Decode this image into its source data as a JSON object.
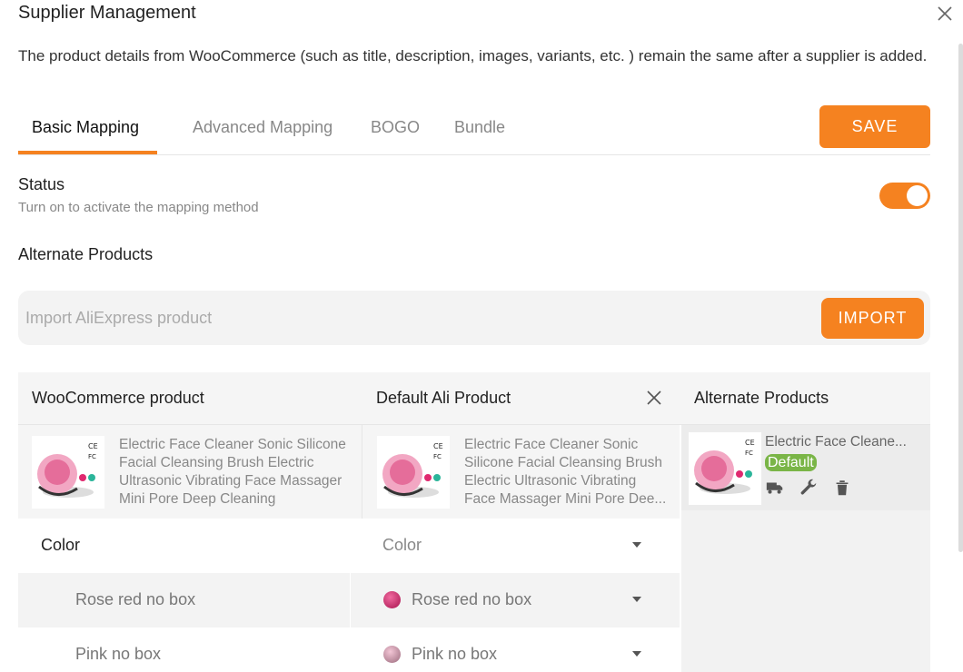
{
  "dialog": {
    "title": "Supplier Management",
    "description": "The product details from WooCommerce (such as title, description, images, variants, etc. ) remain the same after a supplier is added."
  },
  "tabs": [
    {
      "label": "Basic Mapping",
      "active": true
    },
    {
      "label": "Advanced Mapping",
      "active": false
    },
    {
      "label": "BOGO",
      "active": false
    },
    {
      "label": "Bundle",
      "active": false
    }
  ],
  "save_label": "SAVE",
  "status": {
    "label": "Status",
    "hint": "Turn on to activate the mapping method",
    "enabled": true
  },
  "alternate_heading": "Alternate Products",
  "import": {
    "placeholder": "Import AliExpress product",
    "button_label": "IMPORT"
  },
  "table": {
    "headers": {
      "woo": "WooCommerce product",
      "default_ali": "Default Ali Product",
      "alternate": "Alternate Products"
    },
    "woo_product": {
      "title_lines": [
        "Electric Face Cleaner Sonic Silicone",
        "Facial Cleansing Brush Electric",
        "Ultrasonic Vibrating Face Massager",
        "Mini Pore Deep Cleaning"
      ]
    },
    "ali_product": {
      "title_lines": [
        "Electric Face Cleaner Sonic",
        "Silicone Facial Cleansing Brush",
        "Electric Ultrasonic Vibrating",
        "Face Massager Mini Pore Dee..."
      ]
    },
    "alternate_product": {
      "title": "Electric Face Cleane...",
      "badge": "Default"
    },
    "option_rows": [
      {
        "left": "Color",
        "right": "Color",
        "swatch": null
      },
      {
        "left": "Rose red no box",
        "right": "Rose red no box",
        "swatch": "#c2185b"
      },
      {
        "left": "Pink no box",
        "right": "Pink no box",
        "swatch": "#d9a0b4"
      }
    ]
  },
  "colors": {
    "accent": "#f58220",
    "badge_green": "#7ab547"
  }
}
